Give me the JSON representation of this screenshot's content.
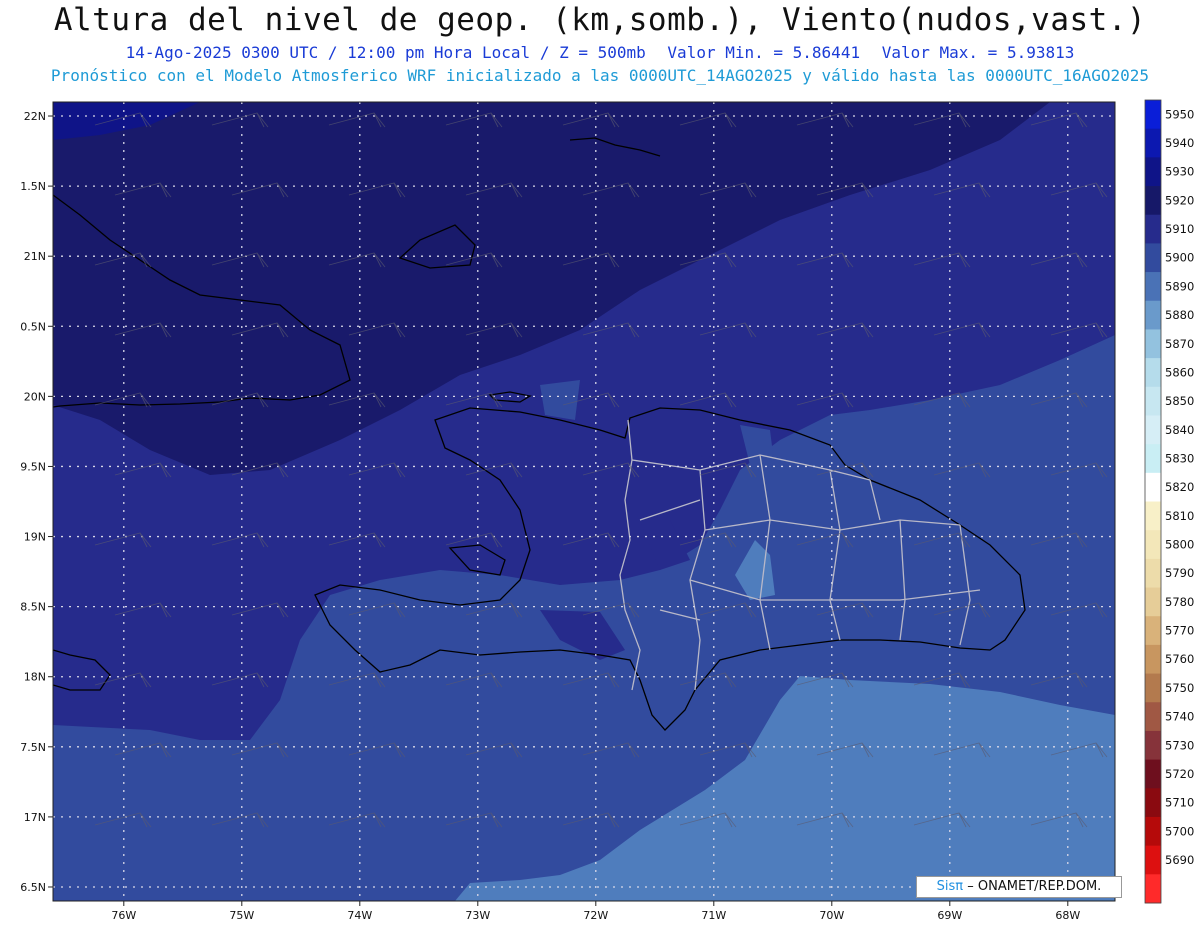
{
  "header": {
    "title": "Altura del nivel de geop. (km,somb.), Viento(nudos,vast.)",
    "datetime": "14-Ago-2025 0300 UTC / 12:00 pm Hora Local / Z = 500mb",
    "min_value": "Valor Min. = 5.86441",
    "max_value": "Valor Max. = 5.93813",
    "model_info": "Pronóstico con el Modelo Atmosferico WRF inicializado a las 0000UTC_14AGO2025 y válido hasta las  0000UTC_16AGO2025"
  },
  "map": {
    "lon_range": [
      -76.6,
      -67.6
    ],
    "lat_range": [
      16.4,
      22.1
    ],
    "lat_ticks": [
      {
        "value": 22.0,
        "label": "22N"
      },
      {
        "value": 21.5,
        "label": "1.5N"
      },
      {
        "value": 21.0,
        "label": "21N"
      },
      {
        "value": 20.5,
        "label": "0.5N"
      },
      {
        "value": 20.0,
        "label": "20N"
      },
      {
        "value": 19.5,
        "label": "9.5N"
      },
      {
        "value": 19.0,
        "label": "19N"
      },
      {
        "value": 18.5,
        "label": "8.5N"
      },
      {
        "value": 18.0,
        "label": "18N"
      },
      {
        "value": 17.5,
        "label": "7.5N"
      },
      {
        "value": 17.0,
        "label": "17N"
      },
      {
        "value": 16.5,
        "label": "6.5N"
      }
    ],
    "lon_ticks": [
      {
        "value": -76,
        "label": "76W"
      },
      {
        "value": -75,
        "label": "75W"
      },
      {
        "value": -74,
        "label": "74W"
      },
      {
        "value": -73,
        "label": "73W"
      },
      {
        "value": -72,
        "label": "72W"
      },
      {
        "value": -71,
        "label": "71W"
      },
      {
        "value": -70,
        "label": "70W"
      },
      {
        "value": -69,
        "label": "69W"
      },
      {
        "value": -68,
        "label": "68W"
      }
    ],
    "shading_colors": {
      "level_5920": "#191a6b",
      "level_5910": "#262b8c",
      "level_5900": "#324b9e",
      "level_5890": "#4f7dbd"
    }
  },
  "colorbar": {
    "levels": [
      {
        "label": "5950",
        "color": "#0a1ed8"
      },
      {
        "label": "5940",
        "color": "#0c18b0"
      },
      {
        "label": "5930",
        "color": "#0f1488"
      },
      {
        "label": "5920",
        "color": "#161868"
      },
      {
        "label": "5910",
        "color": "#262b8c"
      },
      {
        "label": "5900",
        "color": "#324b9e"
      },
      {
        "label": "5890",
        "color": "#4a72b6"
      },
      {
        "label": "5880",
        "color": "#6a9acb"
      },
      {
        "label": "5870",
        "color": "#93c2df"
      },
      {
        "label": "5860",
        "color": "#b5dceb"
      },
      {
        "label": "5850",
        "color": "#c7e7f1"
      },
      {
        "label": "5840",
        "color": "#d6eef6"
      },
      {
        "label": "5830",
        "color": "#c9eef4"
      },
      {
        "label": "5820",
        "color": "#ffffff"
      },
      {
        "label": "5810",
        "color": "#f8f0c8"
      },
      {
        "label": "5800",
        "color": "#f3e7b9"
      },
      {
        "label": "5790",
        "color": "#eddcaa"
      },
      {
        "label": "5780",
        "color": "#e6cd98"
      },
      {
        "label": "5770",
        "color": "#d9b27a"
      },
      {
        "label": "5760",
        "color": "#c89660"
      },
      {
        "label": "5750",
        "color": "#b37a4e"
      },
      {
        "label": "5740",
        "color": "#a05844"
      },
      {
        "label": "5730",
        "color": "#86333a"
      },
      {
        "label": "5720",
        "color": "#6e0f1e"
      },
      {
        "label": "5710",
        "color": "#8a0a10"
      },
      {
        "label": "5700",
        "color": "#b50a0a"
      },
      {
        "label": "5690",
        "color": "#dd1010"
      },
      {
        "label": "",
        "color": "#ff2a2a"
      }
    ]
  },
  "credit": {
    "brand": "Sisπ",
    "text": "– ONAMET/REP.DOM."
  }
}
